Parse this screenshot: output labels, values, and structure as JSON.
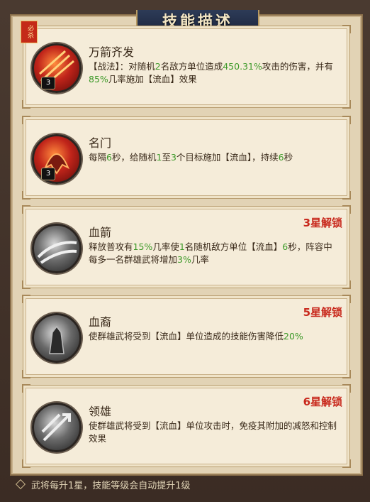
{
  "title": "技能描述",
  "skills": [
    {
      "name": "万箭齐发",
      "badge": "必杀",
      "level": "3",
      "desc_parts": [
        {
          "t": "【战法】：对随机"
        },
        {
          "t": "2",
          "g": true
        },
        {
          "t": "名敌方单位造成"
        },
        {
          "t": "450.31%",
          "g": true
        },
        {
          "t": "攻击的伤害，并有"
        },
        {
          "t": "85%",
          "g": true
        },
        {
          "t": "几率施加【流血】效果"
        }
      ]
    },
    {
      "name": "名门",
      "level": "3",
      "desc_parts": [
        {
          "t": "每隔"
        },
        {
          "t": "6",
          "g": true
        },
        {
          "t": "秒，给随机"
        },
        {
          "t": "1",
          "g": true
        },
        {
          "t": "至"
        },
        {
          "t": "3",
          "g": true
        },
        {
          "t": "个目标施加【流血】，持续"
        },
        {
          "t": "6",
          "g": true
        },
        {
          "t": "秒"
        }
      ]
    },
    {
      "name": "血箭",
      "lock": "3星解锁",
      "desc_parts": [
        {
          "t": "释放普攻有"
        },
        {
          "t": "15%",
          "g": true
        },
        {
          "t": "几率使"
        },
        {
          "t": "1",
          "g": true
        },
        {
          "t": "名随机敌方单位【流血】"
        },
        {
          "t": "6",
          "g": true
        },
        {
          "t": "秒，阵容中每多一名群雄武将增加"
        },
        {
          "t": "3%",
          "g": true
        },
        {
          "t": "几率"
        }
      ]
    },
    {
      "name": "血裔",
      "lock": "5星解锁",
      "desc_parts": [
        {
          "t": "使群雄武将受到【流血】单位造成的技能伤害降低"
        },
        {
          "t": "20%",
          "g": true
        }
      ]
    },
    {
      "name": "领雄",
      "lock": "6星解锁",
      "desc_parts": [
        {
          "t": "使群雄武将受到【流血】单位攻击时，免疫其附加的减怒和控制效果"
        }
      ]
    }
  ],
  "footer": "武将每升1星，技能等级会自动提升1级",
  "colors": {
    "highlight": "#3e9a2a",
    "lock": "#c8281c"
  }
}
